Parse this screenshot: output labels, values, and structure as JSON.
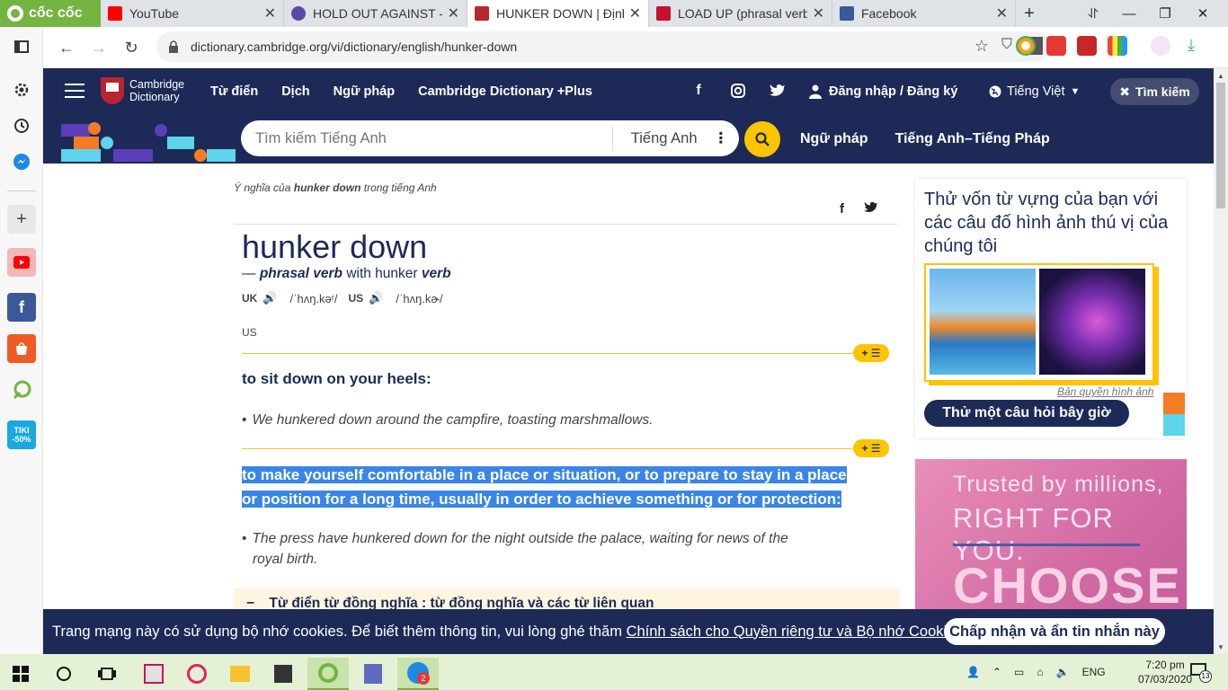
{
  "browser": {
    "brand": "cốc cốc",
    "tabs": [
      {
        "title": "YouTube",
        "icon": "youtube-icon",
        "color": "#ff0000"
      },
      {
        "title": "HOLD OUT AGAINST - Đ",
        "icon": "globe-icon",
        "color": "#5b4aa8"
      },
      {
        "title": "HUNKER DOWN | Định",
        "icon": "cambridge-icon",
        "color": "#b8262d"
      },
      {
        "title": "LOAD UP (phrasal verb)",
        "icon": "bookmark-icon",
        "color": "#c8102e"
      },
      {
        "title": "Facebook",
        "icon": "facebook-icon",
        "color": "#3b5998"
      }
    ],
    "new_tab": "+",
    "url": "dictionary.cambridge.org/vi/dictionary/english/hunker-down"
  },
  "site": {
    "logo_line1": "Cambridge",
    "logo_line2": "Dictionary",
    "nav": [
      "Từ điển",
      "Dịch",
      "Ngữ pháp",
      "Cambridge Dictionary +Plus"
    ],
    "login": "Đăng nhập / Đăng ký",
    "language": "Tiếng Việt",
    "search_btn": "Tìm kiếm",
    "search_placeholder": "Tìm kiếm Tiếng Anh",
    "search_lang": "Tiếng Anh",
    "sub_links": [
      "Ngữ pháp",
      "Tiếng Anh–Tiếng Pháp"
    ],
    "colors": {
      "navy": "#1d2a57",
      "yellow": "#fec400"
    }
  },
  "entry": {
    "crumb_prefix": "Ý nghĩa của",
    "crumb_word": "hunker down",
    "crumb_suffix": "trong tiếng Anh",
    "headword": "hunker down",
    "dash": "—",
    "pos": "phrasal verb",
    "with": "with hunker",
    "pos2": "verb",
    "uk_label": "UK",
    "uk_ipa": "/ˈhʌŋ.kəʳ/",
    "us_label": "US",
    "us_ipa": "/ˈhʌŋ.kɚ/",
    "us_extra": "US",
    "sense_btn": "+ ☰",
    "def1": "to sit down on your heels:",
    "ex1": "We hunkered down around the campfire, toasting marshmallows.",
    "def2_line1": "to make yourself comfortable in a place or situation, or to prepare to stay in a place",
    "def2_line2": "or position for a long time, usually in order to achieve something or for protection:",
    "ex2_line1": "The press have hunkered down for the night outside the palace, waiting for news of the",
    "ex2_line2": "royal birth.",
    "thes_toggle": "−",
    "thesaurus": "Từ điển từ đồng nghĩa : từ đồng nghĩa và các từ liên quan"
  },
  "quiz": {
    "title": "Thử vốn từ vựng của bạn với các câu đố hình ảnh thú vị của chúng tôi",
    "credit": "Bản quyền hình ảnh",
    "button": "Thử một câu hỏi bây giờ"
  },
  "ad": {
    "line1": "Trusted by millions,",
    "line2": "RIGHT FOR YOU.",
    "line3": "CHOOSE"
  },
  "cookie": {
    "text": "Trang mạng này có sử dụng bộ nhớ cookies. Để biết thêm thông tin, vui lòng ghé thăm",
    "link": "Chính sách cho Quyền riêng tư và Bộ nhớ Cookies",
    "period": ".",
    "button": "Chấp nhận và ẩn tin nhắn này"
  },
  "taskbar": {
    "lang": "ENG",
    "time": "7:20 pm",
    "date": "07/03/2020",
    "badge": "2",
    "notif": "13"
  }
}
